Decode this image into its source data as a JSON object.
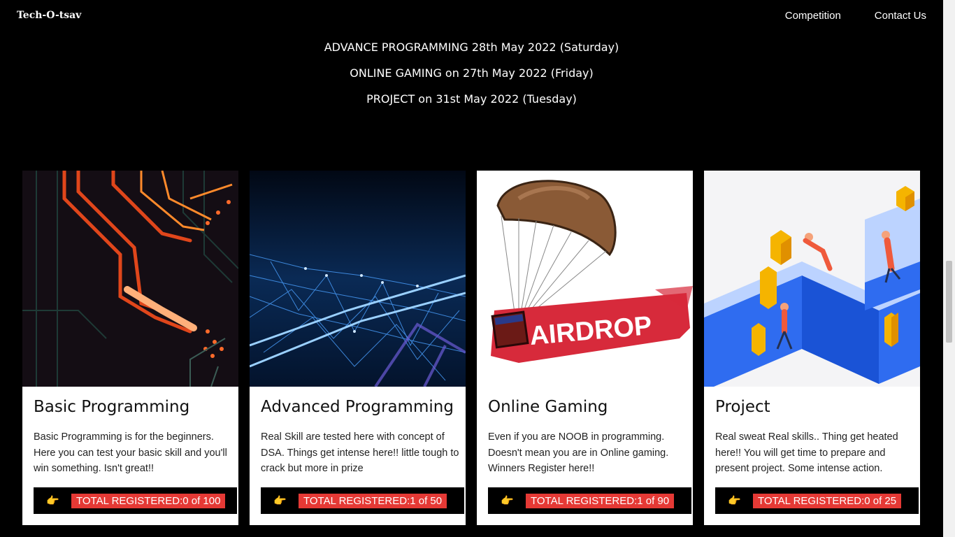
{
  "header": {
    "brand": "Tech-O-tsav",
    "nav": [
      "Competition",
      "Contact Us"
    ]
  },
  "schedule": [
    "ADVANCE PROGRAMMING 28th May 2022 (Saturday)",
    "ONLINE GAMING on 27th May 2022 (Friday)",
    "PROJECT on 31st May 2022 (Tuesday)"
  ],
  "cards": [
    {
      "title": "Basic Programming",
      "description": "Basic Programming is for the beginners. Here you can test your basic skill and you'll win something. Isn't great!!",
      "registered": "TOTAL REGISTERED:0 of 100",
      "icon": "pointing-hand-icon"
    },
    {
      "title": "Advanced Programming",
      "description": "Real Skill are tested here with concept of DSA. Things get intense here!! little tough to crack but more in prize",
      "registered": "TOTAL REGISTERED:1 of 50",
      "icon": "pointing-hand-icon"
    },
    {
      "title": "Online Gaming",
      "description": "Even if you are NOOB in programming. Doesn't mean you are in Online gaming. Winners Register here!!",
      "registered": "TOTAL REGISTERED:1 of 90",
      "image_text": "AIRDROP",
      "icon": "pointing-hand-icon"
    },
    {
      "title": "Project",
      "description": "Real sweat Real skills.. Thing get heated here!! You will get time to prepare and present project. Some intense action.",
      "registered": "TOTAL REGISTERED:0 of 25",
      "icon": "pointing-hand-icon"
    }
  ],
  "colors": {
    "background": "#000000",
    "badge": "#e53935",
    "hand": "#f2b233"
  }
}
